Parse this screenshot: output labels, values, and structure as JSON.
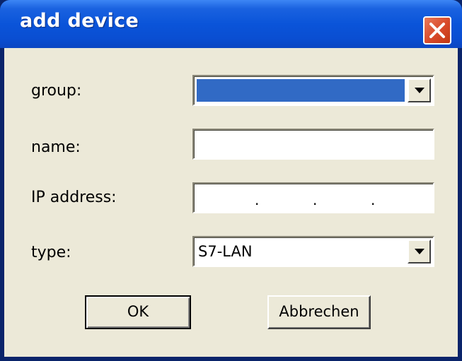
{
  "window": {
    "title": "add device"
  },
  "form": {
    "group_label": "group:",
    "group_value": "",
    "name_label": "name:",
    "name_value": "",
    "ip_label": "IP address:",
    "ip_separator": ".",
    "type_label": "type:",
    "type_value": "S7-LAN"
  },
  "buttons": {
    "ok_label": "OK",
    "cancel_label": "Abbrechen"
  },
  "colors": {
    "titlebar": "#0a54d9",
    "dialog_background": "#ece9d8",
    "selection": "#316ac5",
    "close_button": "#d8492a"
  },
  "icons": {
    "close": "close-icon",
    "dropdown": "chevron-down-icon"
  }
}
